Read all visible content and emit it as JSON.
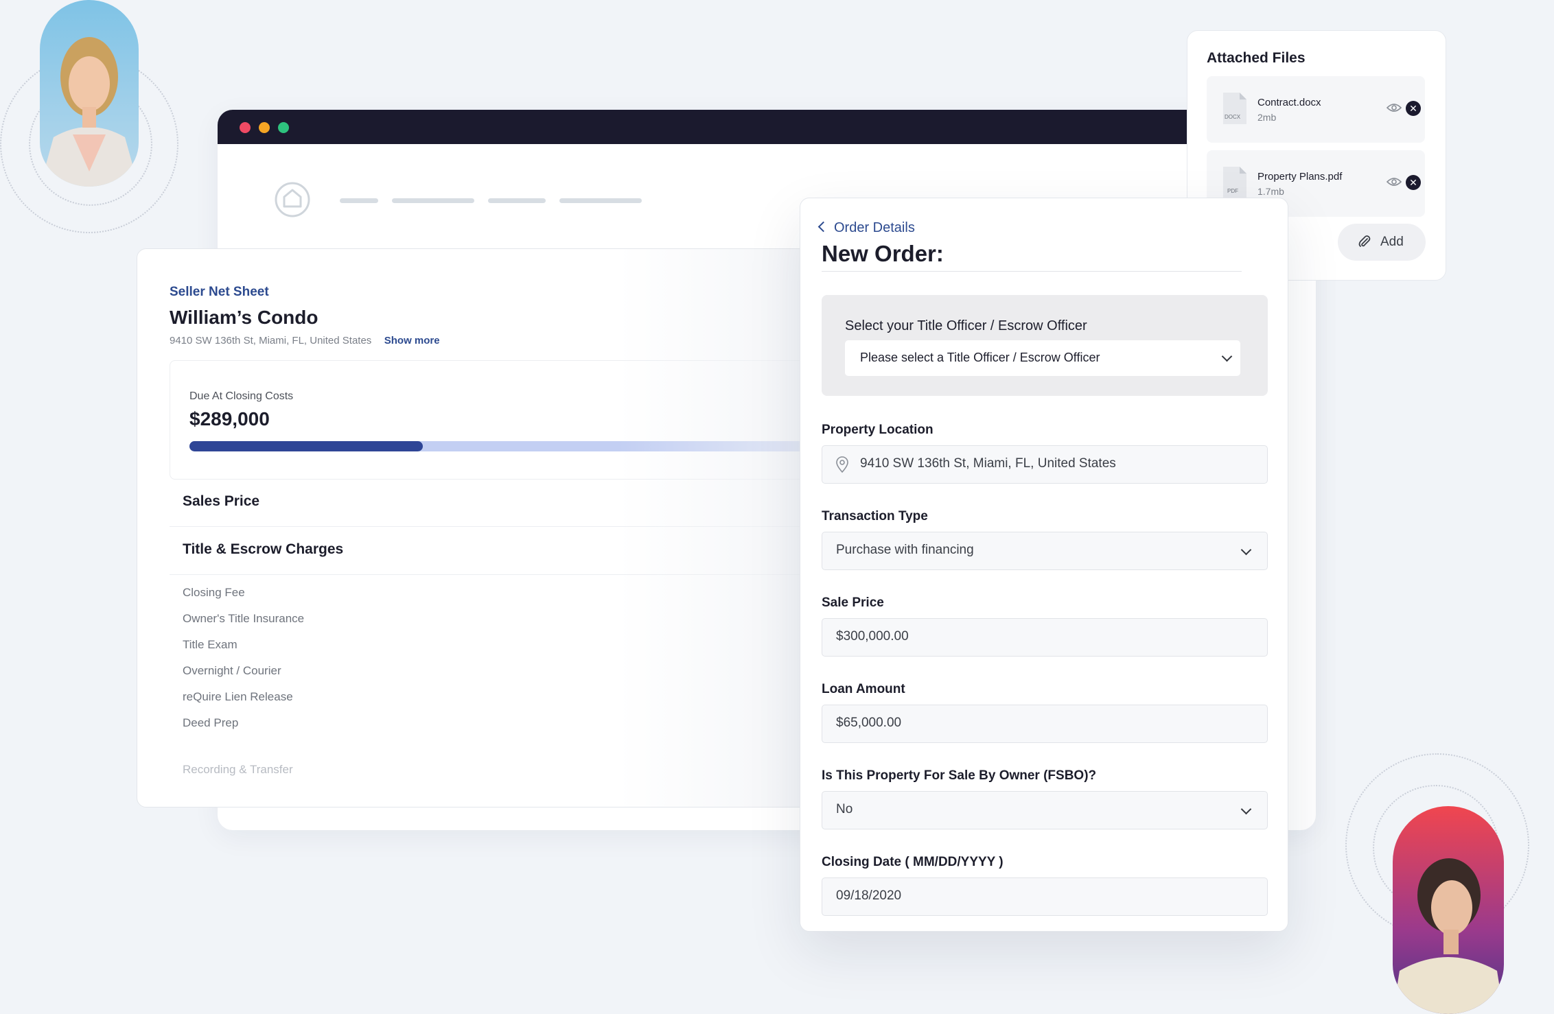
{
  "attached_files": {
    "title": "Attached Files",
    "files": [
      {
        "name": "Contract.docx",
        "size": "2mb",
        "type": "DOCX"
      },
      {
        "name": "Property Plans.pdf",
        "size": "1.7mb",
        "type": "PDF"
      }
    ],
    "add_label": "Add"
  },
  "seller_net_sheet": {
    "eyebrow": "Seller Net Sheet",
    "title": "William’s Condo",
    "address": "9410 SW 136th St, Miami, FL, United States",
    "show_more": "Show more",
    "closing": {
      "label": "Due At Closing Costs",
      "value": "$289,000",
      "progress": 0.34
    },
    "sections": [
      "Sales Price",
      "Title & Escrow Charges"
    ],
    "charges": [
      "Closing Fee",
      "Owner's Title Insurance",
      "Title Exam",
      "Overnight / Courier",
      "reQuire Lien Release",
      "Deed Prep"
    ],
    "faded_charge": "Recording & Transfer"
  },
  "order": {
    "back_label": "Order Details",
    "title": "New Order:",
    "officer": {
      "label": "Select your Title Officer / Escrow Officer",
      "value": "Please select a Title Officer / Escrow Officer"
    },
    "fields": {
      "property_location": {
        "label": "Property Location",
        "value": "9410 SW 136th St, Miami, FL, United States"
      },
      "transaction_type": {
        "label": "Transaction Type",
        "value": "Purchase with financing"
      },
      "sale_price": {
        "label": "Sale Price",
        "value": "$300,000.00"
      },
      "loan_amount": {
        "label": "Loan Amount",
        "value": "$65,000.00"
      },
      "fsbo": {
        "label": "Is This Property For Sale By Owner (FSBO)?",
        "value": "No"
      },
      "closing_date": {
        "label": "Closing Date ( MM/DD/YYYY )",
        "value": "09/18/2020"
      }
    }
  },
  "colors": {
    "accent": "#2c4a8f",
    "progress_fill": "#2e4596",
    "progress_track": "#c3cff3",
    "window_bar": "#1b1a2e",
    "dot_red": "#ef4a64",
    "dot_yellow": "#f5a524",
    "dot_green": "#2ec27e"
  },
  "icons": [
    "person-avatar",
    "house-logo-icon",
    "file-icon",
    "eye-icon",
    "close-icon",
    "paperclip-icon",
    "chevron-left-icon",
    "chevron-down-icon",
    "map-pin-icon"
  ]
}
